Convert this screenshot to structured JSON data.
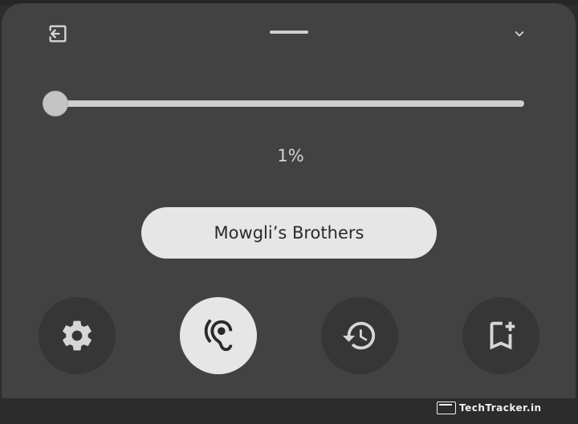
{
  "slider": {
    "value_label": "1%",
    "value_percent": 1
  },
  "profile": {
    "label": "Mowgli’s Brothers"
  },
  "icons": {
    "exit": "exit-to-app-icon",
    "collapse": "chevron-down-icon",
    "settings": "gear-icon",
    "ear": "ear-icon",
    "history": "history-icon",
    "bookmark": "bookmark-add-icon"
  },
  "colors": {
    "panel": "#424242",
    "active_button": "#e6e6e6",
    "inactive_button": "#363636",
    "icon_light": "#d6d6d6",
    "icon_dark": "#2a2a2a"
  },
  "watermark": {
    "text": "TechTracker.in"
  }
}
